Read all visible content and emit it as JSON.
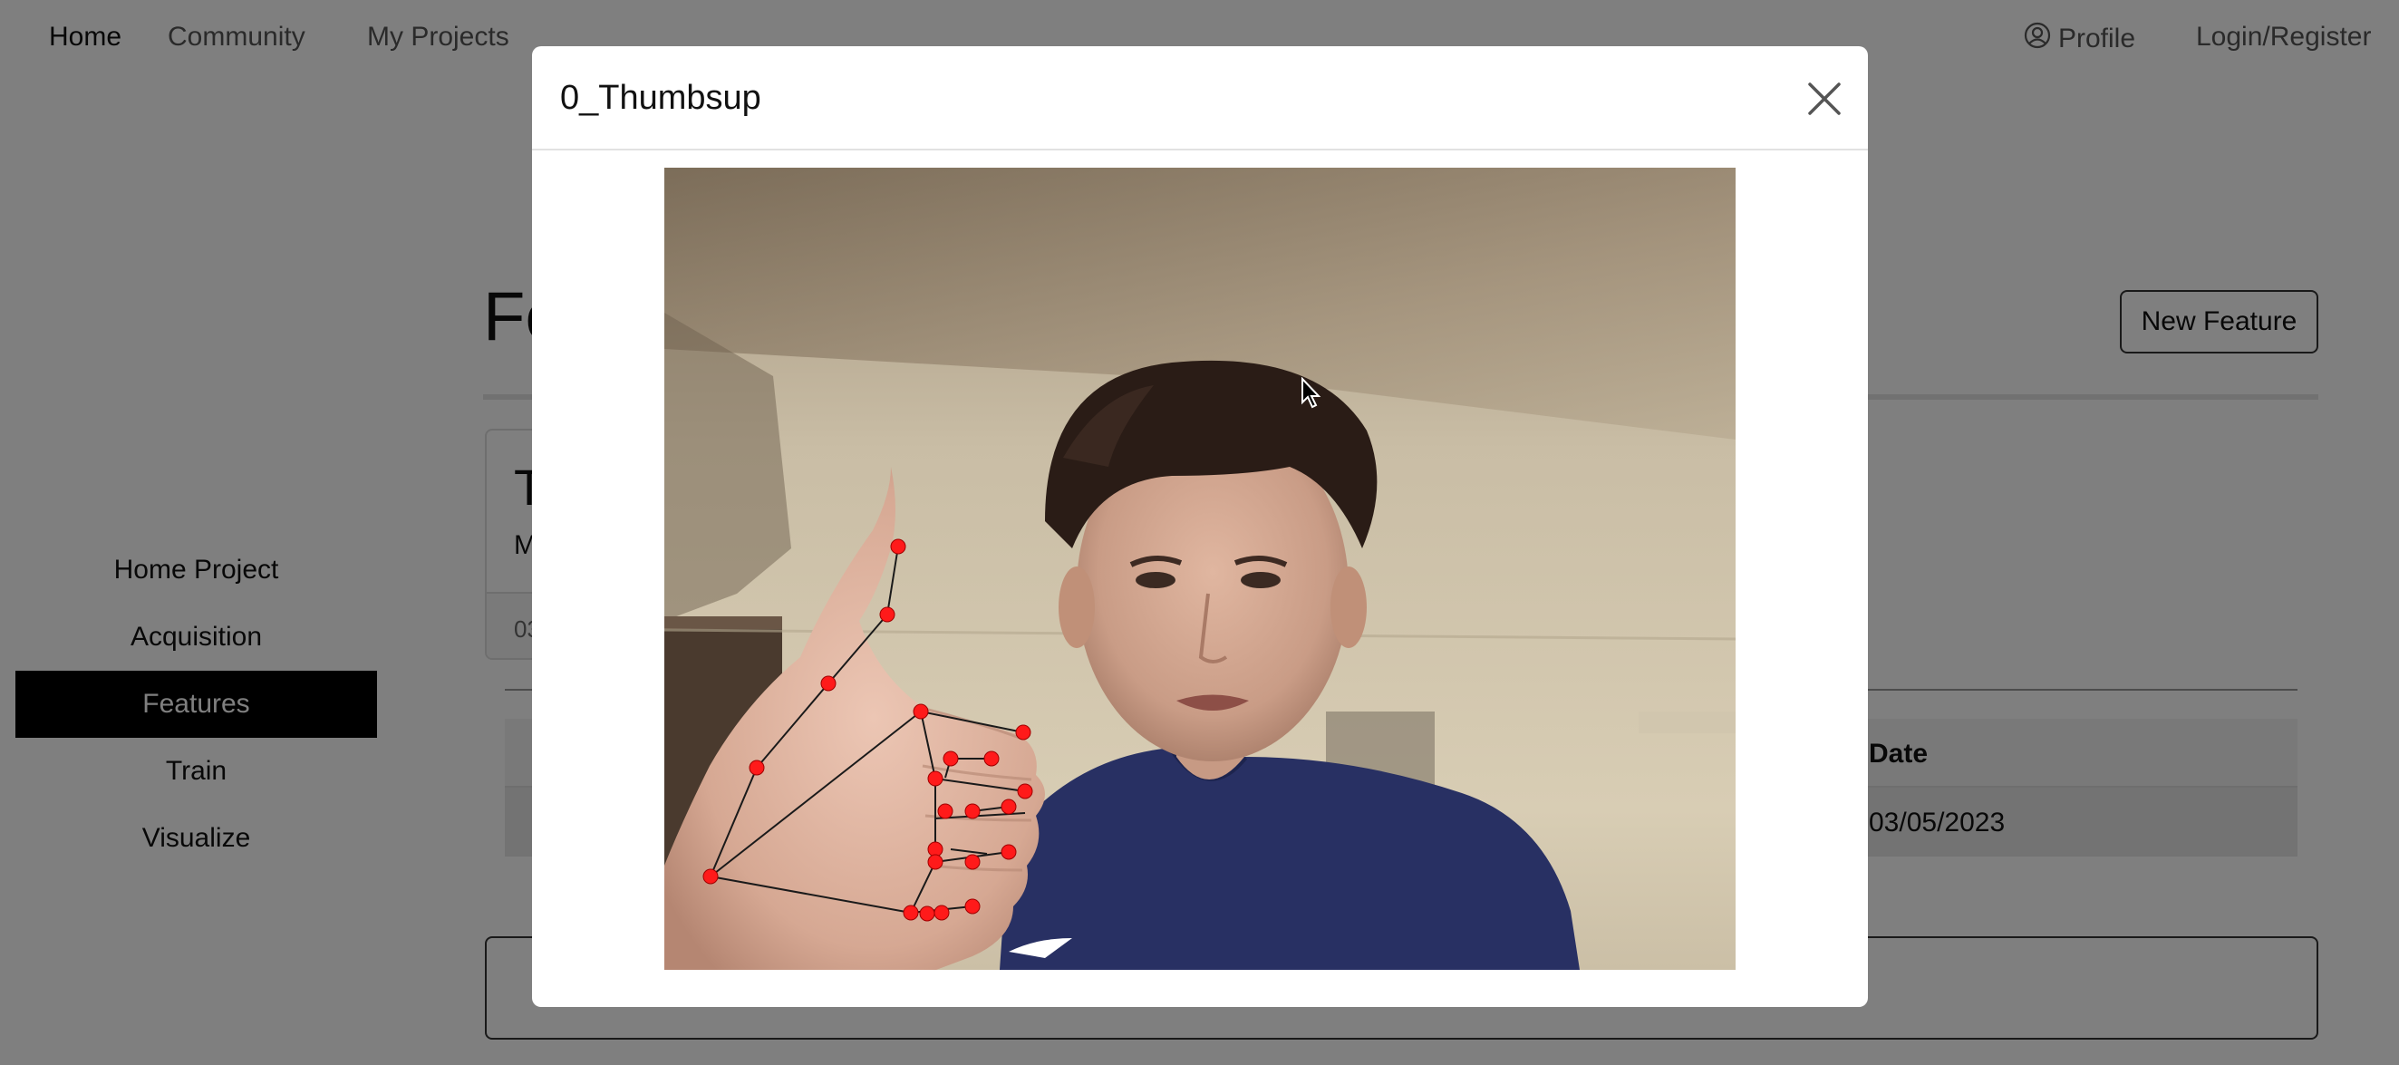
{
  "nav": {
    "home": "Home",
    "community": "Community",
    "my_projects": "My Projects",
    "profile": "Profile",
    "login_register": "Login/Register"
  },
  "page": {
    "title_visible": "Fe",
    "new_feature_label": "New Feature"
  },
  "sidebar": {
    "items": [
      {
        "label": "Home Project",
        "active": false
      },
      {
        "label": "Acquisition",
        "active": false
      },
      {
        "label": "Features",
        "active": true
      },
      {
        "label": "Train",
        "active": false
      },
      {
        "label": "Visualize",
        "active": false
      }
    ]
  },
  "card": {
    "title_visible": "T",
    "text_visible": "M",
    "footer_visible": "03"
  },
  "table": {
    "header_date": "Date",
    "rows": [
      {
        "date": "03/05/2023"
      }
    ]
  },
  "modal": {
    "title": "0_Thumbsup"
  },
  "colors": {
    "backdrop": "rgba(0,0,0,0.5)",
    "active_sidebar": "#000000",
    "landmark": "#ff1a1a"
  },
  "icons": {
    "close": "close-icon",
    "profile": "user-circle-icon",
    "cursor": "mouse-pointer-icon"
  }
}
